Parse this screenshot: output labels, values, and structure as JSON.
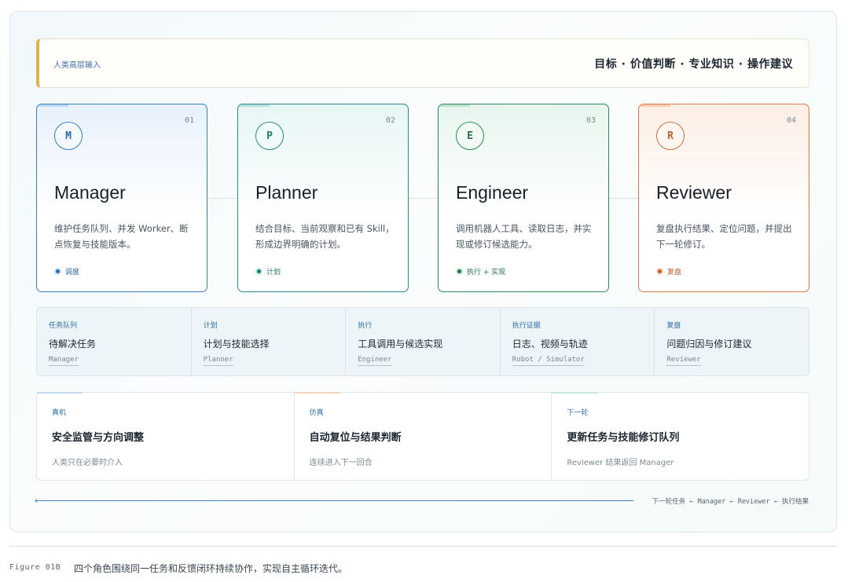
{
  "header": {
    "label": "人类高层输入",
    "goals": "目标 · 价值判断 · 专业知识 · 操作建议"
  },
  "roles": [
    {
      "num": "01",
      "badge": "M",
      "title": "Manager",
      "desc": "维护任务队列、并发 Worker、断点恢复与技能版本。",
      "tag": "调度"
    },
    {
      "num": "02",
      "badge": "P",
      "title": "Planner",
      "desc": "结合目标、当前观察和已有 Skill，形成边界明确的计划。",
      "tag": "计划"
    },
    {
      "num": "03",
      "badge": "E",
      "title": "Engineer",
      "desc": "调用机器人工具、读取日志，并实现或修订候选能力。",
      "tag": "执行 + 实现"
    },
    {
      "num": "04",
      "badge": "R",
      "title": "Reviewer",
      "desc": "复盘执行结果、定位问题，并提出下一轮修订。",
      "tag": "复盘"
    }
  ],
  "flow": [
    {
      "key": "任务队列",
      "value": "待解决任务",
      "source": "Manager"
    },
    {
      "key": "计划",
      "value": "计划与技能选择",
      "source": "Planner"
    },
    {
      "key": "执行",
      "value": "工具调用与候选实现",
      "source": "Engineer"
    },
    {
      "key": "执行证据",
      "value": "日志、视频与轨迹",
      "source": "Robot / Simulator"
    },
    {
      "key": "复盘",
      "value": "问题归因与修订建议",
      "source": "Reviewer"
    }
  ],
  "contexts": [
    {
      "key": "真机",
      "value": "安全监管与方向调整",
      "sub": "人类只在必要时介入"
    },
    {
      "key": "仿真",
      "value": "自动复位与结果判断",
      "sub": "连续进入下一回合"
    },
    {
      "key": "下一轮",
      "value": "更新任务与技能修订队列",
      "sub": "Reviewer 结果返回 Manager"
    }
  ],
  "loop": {
    "arrow": "←",
    "label": "下一轮任务 ← Manager ← Reviewer ← 执行结果"
  },
  "figure": {
    "number": "Figure 01B",
    "caption": "四个角色围绕同一任务和反馈闭环持续协作，实现自主循环迭代。"
  },
  "colors": {
    "manager": "#3a7fc0",
    "planner": "#2b8a8a",
    "engineer": "#2e8a5a",
    "reviewer": "#d97a4a",
    "header_accent": "#e0b14f",
    "loop_line": "#3f7fc4"
  }
}
